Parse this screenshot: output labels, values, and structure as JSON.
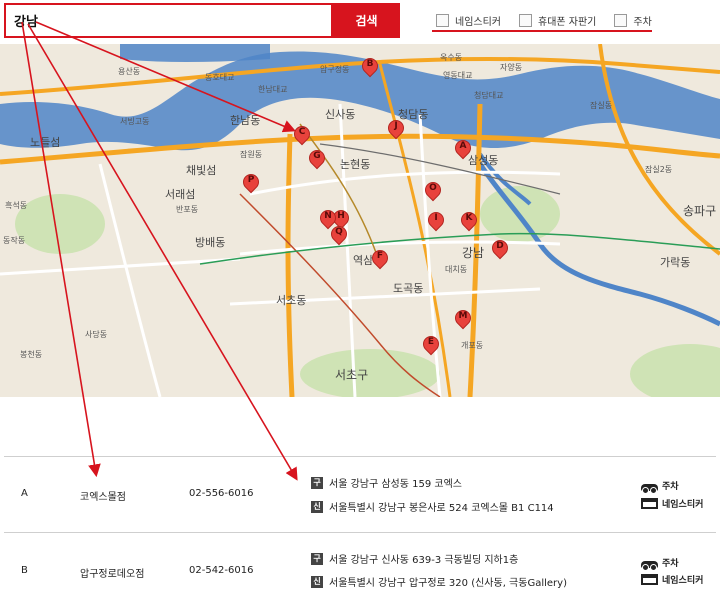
{
  "search": {
    "value": "강남",
    "button_label": "검색"
  },
  "filters": [
    {
      "label": "네임스티커",
      "checked": false
    },
    {
      "label": "휴대폰 자판기",
      "checked": false
    },
    {
      "label": "주차",
      "checked": false
    }
  ],
  "map": {
    "district_labels": [
      "서초구",
      "송파구",
      "강남"
    ],
    "place_labels": [
      "압구정동",
      "신사동",
      "청담동",
      "삼성동",
      "논현동",
      "역삼동",
      "대치동",
      "도곡동",
      "개포동",
      "서초동",
      "반포동",
      "잠원동",
      "잠실동",
      "영동대교",
      "청담대교",
      "한남대교",
      "동호대교",
      "자양동",
      "용산동",
      "서빙고동",
      "노들섬",
      "흑석동",
      "동작동",
      "사당동",
      "방배동",
      "봉천동",
      "채빛섬",
      "서래섬",
      "잠실2동",
      "가락동",
      "한남동",
      "옥수동"
    ],
    "pins": [
      "A",
      "B",
      "C",
      "D",
      "E",
      "F",
      "G",
      "H",
      "I",
      "J",
      "K",
      "M",
      "N",
      "O",
      "P",
      "Q"
    ]
  },
  "stores": [
    {
      "code": "A",
      "name": "코엑스몰점",
      "phone": "02-556-6016",
      "old_addr_tag": "구",
      "old_addr": "서울 강남구 삼성동 159 코엑스",
      "new_addr_tag": "신",
      "new_addr": "서울특별시 강남구 봉은사로 524 코엑스몰 B1 C114",
      "services": [
        "주차",
        "네임스티커"
      ]
    },
    {
      "code": "B",
      "name": "압구정로데오점",
      "phone": "02-542-6016",
      "old_addr_tag": "구",
      "old_addr": "서울 강남구 신사동 639-3 극동빌딩 지하1층",
      "new_addr_tag": "신",
      "new_addr": "서울특별시 강남구 압구정로 320 (신사동, 극동Gallery)",
      "services": [
        "주차",
        "네임스티커"
      ]
    }
  ],
  "colors": {
    "accent": "#d7141e",
    "river": "#4f85c8",
    "road_major": "#f5a623",
    "pin": "#e8423c"
  }
}
